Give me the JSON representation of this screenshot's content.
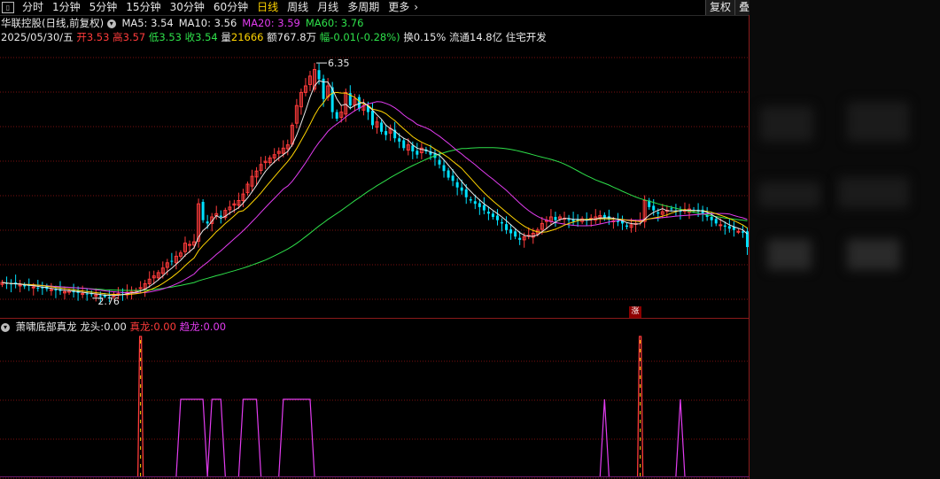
{
  "toolbar": {
    "tabs": [
      {
        "label": "分时",
        "active": false
      },
      {
        "label": "1分钟",
        "active": false
      },
      {
        "label": "5分钟",
        "active": false
      },
      {
        "label": "15分钟",
        "active": false
      },
      {
        "label": "30分钟",
        "active": false
      },
      {
        "label": "60分钟",
        "active": false
      },
      {
        "label": "日线",
        "active": true
      },
      {
        "label": "周线",
        "active": false
      },
      {
        "label": "月线",
        "active": false
      },
      {
        "label": "多周期",
        "active": false
      },
      {
        "label": "更多",
        "active": false
      }
    ],
    "more_arrow": "›",
    "fuquan": "复权",
    "overlay": "叠"
  },
  "header": {
    "stock_name": "华联控股(日线,前复权)",
    "ma": [
      {
        "label": "MA5:",
        "value": "3.54",
        "color": "#e8e8e8"
      },
      {
        "label": "MA10:",
        "value": "3.56",
        "color": "#e8e8e8"
      },
      {
        "label": "MA20:",
        "value": "3.59",
        "color": "#e23cf0"
      },
      {
        "label": "MA60:",
        "value": "3.76",
        "color": "#2ee04a"
      }
    ],
    "date": "2025/05/30/五",
    "open_label": "开",
    "open": "3.53",
    "high_label": "高",
    "high": "3.57",
    "low_label": "低",
    "low": "3.53",
    "close_label": "收",
    "close": "3.54",
    "vol_label": "量",
    "vol": "21666",
    "amt_label": "额",
    "amt": "767.8万",
    "chg_label": "幅",
    "chg": "-0.01(-0.28%)",
    "turnover": "换0.15%",
    "float_cap": "流通14.8亿",
    "sector": "住宅开发"
  },
  "price_chart": {
    "high_label": "6.35",
    "low_label": "2.76",
    "candles_count": 168,
    "high_idx": 70,
    "low_idx": 23,
    "colors": {
      "up": "#ff3b3b",
      "down": "#00e1ff",
      "ma5": "#e8e8e8",
      "ma10": "#ffd400",
      "ma20": "#e23cf0",
      "ma60": "#2ee04a",
      "grid": "#7a1010"
    },
    "closes": [
      3.0,
      2.98,
      2.97,
      2.97,
      2.96,
      2.94,
      2.95,
      2.93,
      2.92,
      2.91,
      2.9,
      2.89,
      2.88,
      2.87,
      2.86,
      2.87,
      2.85,
      2.84,
      2.83,
      2.82,
      2.82,
      2.81,
      2.8,
      2.78,
      2.8,
      2.82,
      2.83,
      2.84,
      2.85,
      2.86,
      2.88,
      2.92,
      2.98,
      3.05,
      3.1,
      3.15,
      3.22,
      3.3,
      3.32,
      3.4,
      3.45,
      3.6,
      3.58,
      3.62,
      4.2,
      3.95,
      3.9,
      4.0,
      4.05,
      4.0,
      4.1,
      4.15,
      4.2,
      4.25,
      4.35,
      4.5,
      4.62,
      4.7,
      4.8,
      4.85,
      4.9,
      4.95,
      5.0,
      5.05,
      5.1,
      5.4,
      5.7,
      5.9,
      6.0,
      6.15,
      6.25,
      6.1,
      5.8,
      6.0,
      5.6,
      5.5,
      5.6,
      5.9,
      5.7,
      5.8,
      5.65,
      5.7,
      5.6,
      5.4,
      5.45,
      5.3,
      5.25,
      5.35,
      5.2,
      5.15,
      5.05,
      5.1,
      5.0,
      4.95,
      5.05,
      5.0,
      4.95,
      4.9,
      4.8,
      4.7,
      4.6,
      4.55,
      4.45,
      4.4,
      4.3,
      4.25,
      4.2,
      4.15,
      4.1,
      4.05,
      4.0,
      3.95,
      3.9,
      3.8,
      3.75,
      3.7,
      3.65,
      3.7,
      3.72,
      3.75,
      3.8,
      3.9,
      3.95,
      4.0,
      3.95,
      4.0,
      3.98,
      3.95,
      3.93,
      3.95,
      3.97,
      3.95,
      3.98,
      4.0,
      4.02,
      3.98,
      3.96,
      3.94,
      3.92,
      3.9,
      3.85,
      3.88,
      3.9,
      3.95,
      4.25,
      4.15,
      4.1,
      4.05,
      4.08,
      4.1,
      4.12,
      4.1,
      4.08,
      4.1,
      4.12,
      4.1,
      4.08,
      4.05,
      4.0,
      3.95,
      3.9,
      3.88,
      3.85,
      3.82,
      3.8,
      3.78,
      3.76,
      3.54
    ],
    "ylim": [
      2.5,
      6.5
    ]
  },
  "indicator": {
    "title": "萧啸底部真龙",
    "longtou_label": "龙头:",
    "longtou_value": "0.00",
    "zhenlong_label": "真龙:",
    "zhenlong_value": "0.00",
    "qulong_label": "趋龙:",
    "qulong_value": "0.00",
    "colors": {
      "zhenlong": "#ff3b3b",
      "longtou": "#ffd400",
      "qulong": "#e23cf0"
    },
    "zhenlong_spikes": [
      {
        "idx": 31,
        "value": 1.0
      },
      {
        "idx": 143,
        "value": 1.0
      }
    ],
    "qulong_plateaus": [
      [
        40,
        45
      ],
      [
        47,
        49
      ],
      [
        54,
        57
      ],
      [
        63,
        69
      ]
    ],
    "qulong_spikes": [
      135,
      152
    ]
  },
  "badge": {
    "text": "涨"
  }
}
